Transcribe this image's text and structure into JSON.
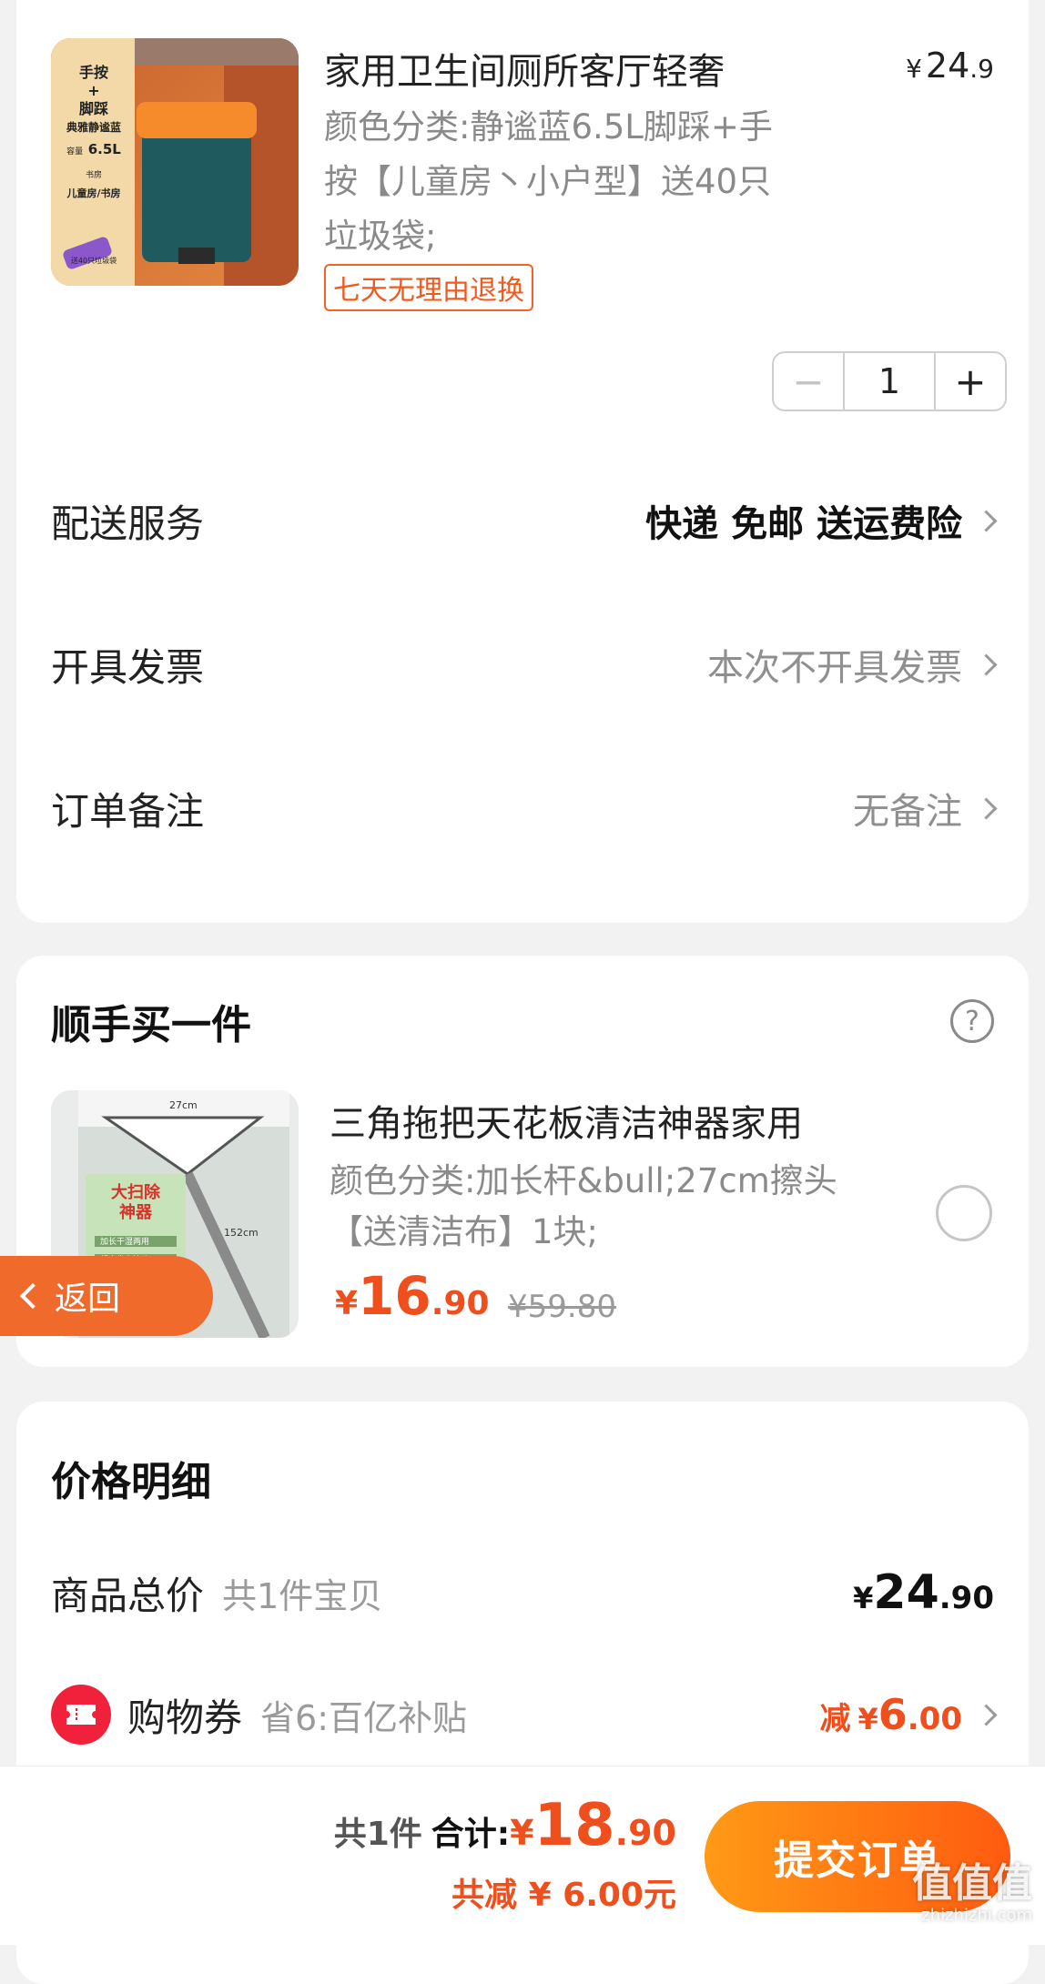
{
  "product": {
    "title": "家用卫生间厕所客厅轻奢",
    "spec_line1": "颜色分类:静谧蓝6.5L脚踩+手",
    "spec_line2": "按【儿童房丶小户型】送40只",
    "spec_line3": "垃圾袋;",
    "price_symbol": "¥",
    "price_int": "24",
    "price_dec": ".9",
    "badge": "七天无理由退换",
    "quantity": "1",
    "minus": "−",
    "plus": "+",
    "image_tag_top": "手按",
    "image_tag_plus": "+",
    "image_tag_bottom": "脚踩",
    "image_tag_sub": "典雅静谧蓝",
    "image_tag_cap_label": "容量",
    "image_tag_cap": "6.5L",
    "image_tag_room_label": "书房",
    "image_tag_room": "儿童房/书房",
    "image_tag_gift": "送40只垃圾袋"
  },
  "rows": {
    "delivery_label": "配送服务",
    "delivery_value": "快递 免邮 送运费险",
    "invoice_label": "开具发票",
    "invoice_value": "本次不开具发票",
    "note_label": "订单备注",
    "note_value": "无备注"
  },
  "addon": {
    "title": "顺手买一件",
    "help": "?",
    "item_title": "三角拖把天花板清洁神器家用",
    "item_spec1": "颜色分类:加长杆&bull;27cm擦头",
    "item_spec2": "【送清洁布】1块;",
    "price_symbol": "¥",
    "price_int": "16",
    "price_dec": ".90",
    "orig_price": "¥59.80",
    "image_size_top": "27cm",
    "image_size_side": "152cm",
    "image_tag1": "大扫除",
    "image_tag2": "神器",
    "image_line1": "加长干湿两用",
    "image_line2": "超大省力擦头"
  },
  "detail": {
    "title": "价格明细",
    "total_label": "商品总价",
    "total_note": "共1件宝贝",
    "total_symbol": "¥",
    "total_int": "24",
    "total_dec": ".90",
    "coupon_label": "购物券",
    "coupon_note": "省6:百亿补贴",
    "coupon_prefix": "减",
    "coupon_symbol": "¥",
    "coupon_int": "6",
    "coupon_dec": ".00"
  },
  "bottom": {
    "count": "共1件",
    "sum_label": "合计:",
    "sum_symbol": "¥",
    "sum_int": "18",
    "sum_dec": ".90",
    "saved": "共减 ¥ 6.00元",
    "submit": "提交订单"
  },
  "back_button": "返回",
  "watermark": {
    "main": "值值值",
    "sub": "zhizhizhi.com"
  },
  "colors": {
    "accent": "#ef4f1c",
    "submit_from": "#ff9a16",
    "submit_to": "#ff5b10",
    "coupon_icon": "#f2213b"
  }
}
